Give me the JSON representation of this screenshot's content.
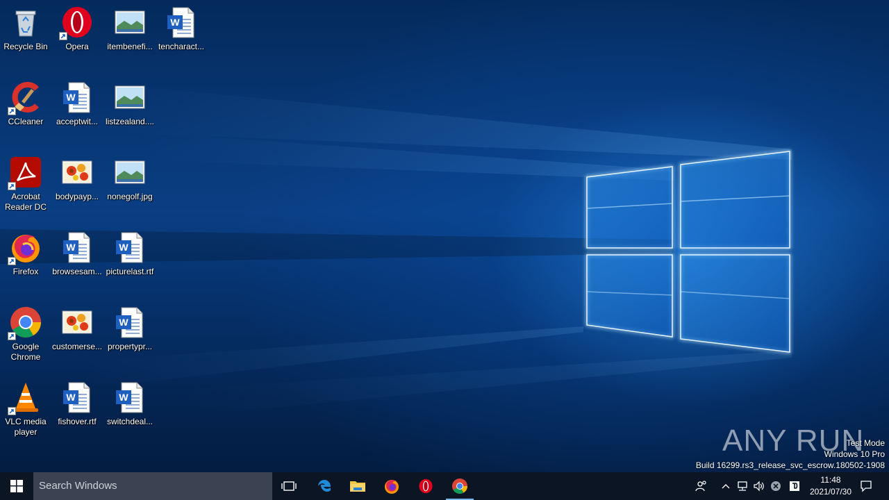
{
  "desktop": {
    "icons": [
      {
        "label": "Recycle Bin",
        "icon": "recycle-bin-icon"
      },
      {
        "label": "Opera",
        "icon": "opera-icon"
      },
      {
        "label": "itembenefi...",
        "icon": "image-file-icon"
      },
      {
        "label": "tencharact...",
        "icon": "word-doc-icon"
      },
      {
        "label": "CCleaner",
        "icon": "ccleaner-icon"
      },
      {
        "label": "acceptwit...",
        "icon": "word-doc-icon"
      },
      {
        "label": "listzealand....",
        "icon": "image-file-icon"
      },
      {
        "label": "Acrobat Reader DC",
        "icon": "acrobat-icon"
      },
      {
        "label": "bodypayp...",
        "icon": "flower-image-icon"
      },
      {
        "label": "nonegolf.jpg",
        "icon": "image-file-icon"
      },
      {
        "label": "Firefox",
        "icon": "firefox-icon"
      },
      {
        "label": "browsesam...",
        "icon": "word-doc-icon"
      },
      {
        "label": "picturelast.rtf",
        "icon": "word-doc-icon"
      },
      {
        "label": "Google Chrome",
        "icon": "chrome-icon"
      },
      {
        "label": "customerse...",
        "icon": "flower-image-icon"
      },
      {
        "label": "propertypr...",
        "icon": "word-doc-icon"
      },
      {
        "label": "VLC media player",
        "icon": "vlc-icon"
      },
      {
        "label": "fishover.rtf",
        "icon": "word-doc-icon"
      },
      {
        "label": "switchdeal...",
        "icon": "word-doc-icon"
      }
    ]
  },
  "watermark": {
    "brand": "ANY RUN",
    "mode": "Test Mode",
    "edition": "Windows 10 Pro",
    "build": "Build 16299.rs3_release_svc_escrow.180502-1908"
  },
  "taskbar": {
    "search_placeholder": "Search Windows",
    "apps": [
      "task-view-icon",
      "edge-icon",
      "file-explorer-icon",
      "firefox-icon",
      "opera-icon",
      "chrome-icon"
    ],
    "clock": {
      "time": "11:48",
      "date": "2021/07/30"
    }
  },
  "colors": {
    "taskbar": "#0b1524",
    "search": "#3b4352",
    "accent": "#76b9ed"
  }
}
